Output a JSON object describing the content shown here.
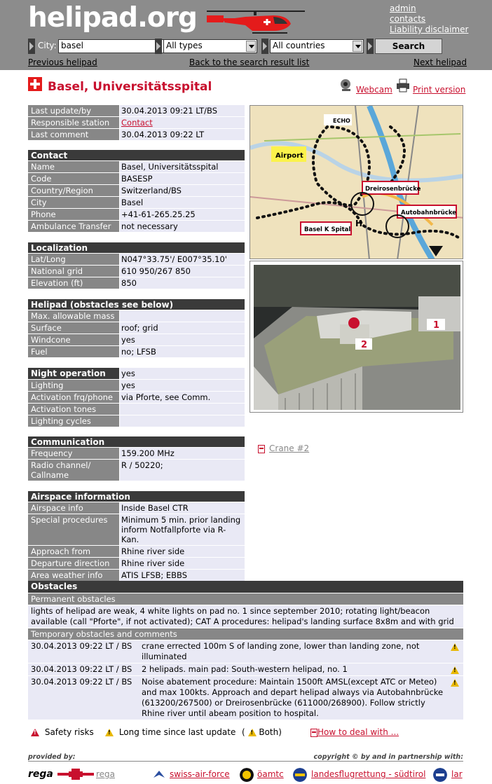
{
  "header": {
    "logo": "helipad.org",
    "links": [
      "admin",
      "contacts",
      "Liability disclaimer"
    ]
  },
  "search": {
    "city_label": "City:",
    "city_value": "basel",
    "type_value": "All types",
    "country_value": "All countries",
    "button": "Search"
  },
  "nav": {
    "prev": "Previous helipad",
    "back": "Back to the search result list",
    "next": "Next helipad"
  },
  "title": "Basel, Universitätsspital",
  "tools": {
    "webcam": "Webcam",
    "print": "Print version"
  },
  "meta": [
    {
      "k": "Last update/by",
      "v": "30.04.2013 09:21 LT/BS"
    },
    {
      "k": "Responsible station",
      "v": "Contact",
      "link": true
    },
    {
      "k": "Last comment",
      "v": "30.04.2013 09:22 LT"
    }
  ],
  "contact": {
    "header": "Contact",
    "rows": [
      {
        "k": "Name",
        "v": "Basel, Universitätsspital"
      },
      {
        "k": "Code",
        "v": "BASESP"
      },
      {
        "k": "Country/Region",
        "v": "Switzerland/BS"
      },
      {
        "k": "City",
        "v": "Basel"
      },
      {
        "k": "Phone",
        "v": "+41-61-265.25.25"
      },
      {
        "k": "Ambulance Transfer",
        "v": "not necessary"
      }
    ]
  },
  "localization": {
    "header": "Localization",
    "rows": [
      {
        "k": "Lat/Long",
        "v": "N047°33.75'/ E007°35.10'"
      },
      {
        "k": "National grid",
        "v": "610 950/267 850"
      },
      {
        "k": "Elevation (ft)",
        "v": "850"
      }
    ]
  },
  "helipad": {
    "header": "Helipad (obstacles see below)",
    "rows": [
      {
        "k": "Max. allowable mass",
        "v": ""
      },
      {
        "k": "Surface",
        "v": "roof; grid"
      },
      {
        "k": "Windcone",
        "v": "yes"
      },
      {
        "k": "Fuel",
        "v": "no; LFSB"
      }
    ]
  },
  "night": {
    "header": "Night operation",
    "header_value": "yes",
    "rows": [
      {
        "k": "Lighting",
        "v": "yes"
      },
      {
        "k": "Activation frq/phone",
        "v": "via Pforte, see Comm."
      },
      {
        "k": "Activation tones",
        "v": ""
      },
      {
        "k": "Lighting cycles",
        "v": ""
      }
    ]
  },
  "communication": {
    "header": "Communication",
    "rows": [
      {
        "k": "Frequency",
        "v": "159.200 MHz"
      },
      {
        "k": "Radio channel/ Callname",
        "v": "R / 50220;"
      }
    ]
  },
  "airspace": {
    "header": "Airspace information",
    "rows": [
      {
        "k": "Airspace info",
        "v": "Inside Basel CTR"
      },
      {
        "k": "Special procedures",
        "v": "Minimum 5 min. prior landing inform Notfallpforte via R-Kan."
      },
      {
        "k": "Approach from",
        "v": "Rhine river side"
      },
      {
        "k": "Departure direction",
        "v": "Rhine river side"
      },
      {
        "k": "Area weather info",
        "v": "ATIS LFSB; EBBS"
      }
    ]
  },
  "map_labels": {
    "echo": "ECHO",
    "airport": "Airport",
    "dreirosen": "Dreirosenbrücke",
    "autobahn": "Autobahnbrücke",
    "spital": "Basel K Spital",
    "h": "H"
  },
  "photo_labels": {
    "one": "1",
    "two": "2"
  },
  "crane_link": "Crane #2",
  "obstacles": {
    "header": "Obstacles",
    "permanent_header": "Permanent obstacles",
    "permanent_text": "lights of helipad are weak, 4 white lights on pad no. 1 since september 2010; rotating light/beacon available (call \"Pforte\", if not activated); CAT A procedures: helipad's landing surface 8x8m and with grid",
    "temporary_header": "Temporary obstacles and comments",
    "temporary": [
      {
        "date": "30.04.2013 09:22 LT / BS",
        "text": "crane errected 100m S of landing zone, lower than landing zone, not illuminated"
      },
      {
        "date": "30.04.2013 09:22 LT / BS",
        "text": "2 helipads. main pad: South-western helipad, no. 1"
      },
      {
        "date": "30.04.2013 09:22 LT / BS",
        "text": "Noise abatement procedure: Maintain 1500ft AMSL(except ATC or Meteo) and max 100kts. Approach and depart helipad always via Autobahnbrücke (613200/267500) or Dreirosenbrücke (611000/268900). Follow strictly Rhine river until abeam position to hospital."
      }
    ]
  },
  "legend": {
    "safety": "Safety risks",
    "longtime": "Long time since last update",
    "both_open": "(",
    "both_close": "Both)",
    "howto": "How to deal with ..."
  },
  "footer": {
    "provided": "provided by:",
    "copyright": "copyright © by and in partnership with:",
    "rega_logo": "rega",
    "rega": "rega",
    "partners": [
      "swiss-air-force",
      "öamtc",
      "landesflugrettung - südtirol",
      "lar"
    ]
  },
  "colors": {
    "accent": "#c8102e",
    "header_bg": "#8c8c8c",
    "dark": "#3a3a3a",
    "key_bg": "#878787",
    "val_bg": "#e9e9f5"
  }
}
